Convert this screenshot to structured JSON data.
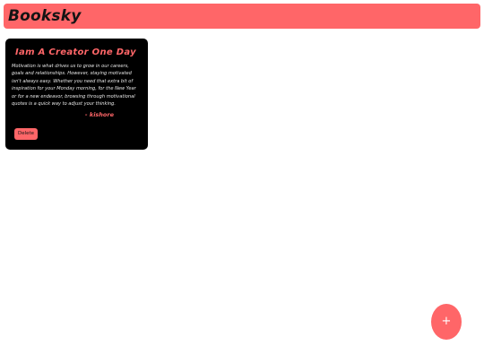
{
  "header": {
    "title": "Booksky"
  },
  "notes": [
    {
      "title": "Iam A Creator One Day",
      "body": "Motivation is what drives us to grow in our careers, goals and relationships. However, staying motivated isn't always easy. Whether you need that extra bit of inspiration for your Monday morning, for the New Year or for a new endeavor, browsing through motivational quotes is a quick way to adjust your thinking.",
      "author": "- kishore",
      "delete_label": "Delete"
    }
  ],
  "fab": {
    "label": "+"
  },
  "colors": {
    "accent": "#ff6668",
    "card_bg": "#000000",
    "page_bg": "#ffffff"
  }
}
